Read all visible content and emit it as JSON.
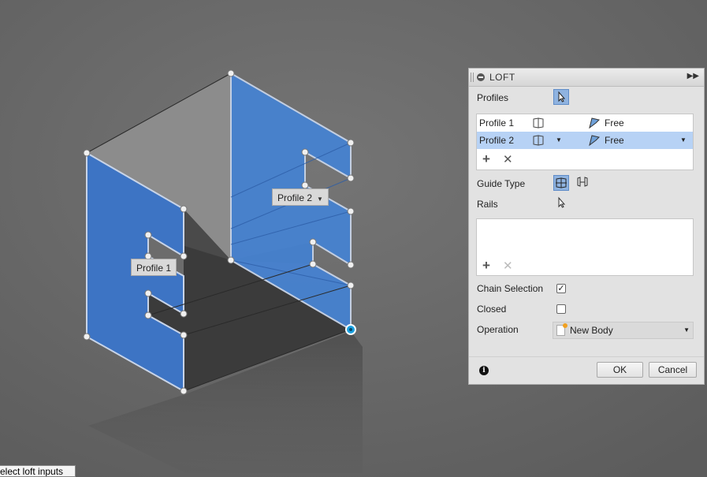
{
  "viewport": {
    "profile1_label": "Profile 1",
    "profile2_label": "Profile 2",
    "status_tip": "elect loft inputs"
  },
  "dialog": {
    "title": "LOFT",
    "profiles_label": "Profiles",
    "profiles": [
      {
        "name": "Profile 1",
        "type": "Free",
        "selected": false
      },
      {
        "name": "Profile 2",
        "type": "Free",
        "selected": true
      }
    ],
    "guide_type_label": "Guide Type",
    "rails_label": "Rails",
    "chain_selection_label": "Chain Selection",
    "chain_selection_checked": true,
    "closed_label": "Closed",
    "closed_checked": false,
    "operation_label": "Operation",
    "operation_value": "New Body",
    "ok_label": "OK",
    "cancel_label": "Cancel"
  },
  "colors": {
    "background": "#6a6a6a",
    "profile_face": "#3d74c4",
    "selected_row": "#b7d2f5",
    "accent_point": "#1aa0e0"
  }
}
